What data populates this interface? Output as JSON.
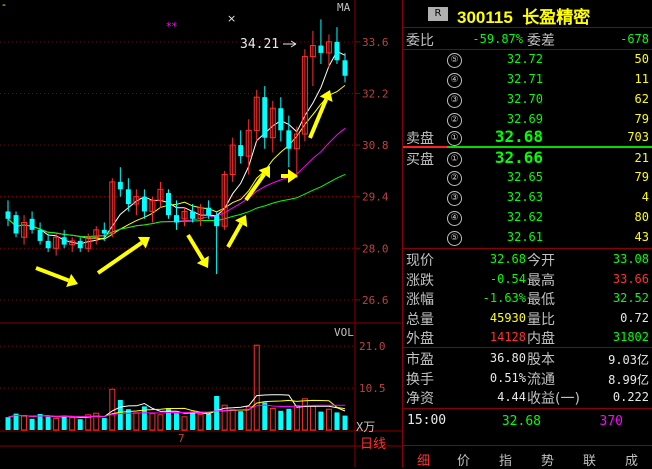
{
  "chart": {
    "ma_label": "MA",
    "vol_label": "VOL",
    "unit_label": "X万",
    "month_label": "7",
    "daily_label": "日线",
    "stars": "**",
    "high_label": "34.21",
    "price_axis": [
      "33.6",
      "32.2",
      "30.8",
      "29.4",
      "28.0",
      "26.6"
    ],
    "vol_axis": [
      "21.0",
      "10.5"
    ],
    "colors": {
      "up": "#ff3030",
      "down": "#00ffff",
      "ma5": "#ffffff",
      "ma10": "#ffff00",
      "ma20": "#ff00ff",
      "ma60": "#00ff00",
      "grid": "#8b0000",
      "arrow": "#ffff00"
    }
  },
  "chart_data": {
    "type": "candlestick",
    "ylim": [
      26.0,
      34.6
    ],
    "candles": [
      {
        "o": 29.0,
        "h": 29.3,
        "l": 28.6,
        "c": 28.8
      },
      {
        "o": 28.9,
        "h": 29.0,
        "l": 28.3,
        "c": 28.4
      },
      {
        "o": 28.3,
        "h": 28.9,
        "l": 28.1,
        "c": 28.7
      },
      {
        "o": 28.8,
        "h": 29.0,
        "l": 28.4,
        "c": 28.5
      },
      {
        "o": 28.5,
        "h": 28.7,
        "l": 28.1,
        "c": 28.2
      },
      {
        "o": 28.2,
        "h": 28.4,
        "l": 27.9,
        "c": 28.0
      },
      {
        "o": 28.0,
        "h": 28.4,
        "l": 27.8,
        "c": 28.3
      },
      {
        "o": 28.3,
        "h": 28.5,
        "l": 28.0,
        "c": 28.1
      },
      {
        "o": 28.1,
        "h": 28.3,
        "l": 27.9,
        "c": 28.2
      },
      {
        "o": 28.2,
        "h": 28.3,
        "l": 27.9,
        "c": 28.0
      },
      {
        "o": 28.0,
        "h": 28.4,
        "l": 27.9,
        "c": 28.3
      },
      {
        "o": 28.3,
        "h": 28.6,
        "l": 28.1,
        "c": 28.5
      },
      {
        "o": 28.5,
        "h": 28.7,
        "l": 28.2,
        "c": 28.4
      },
      {
        "o": 28.4,
        "h": 29.9,
        "l": 28.3,
        "c": 29.8
      },
      {
        "o": 29.8,
        "h": 30.2,
        "l": 29.4,
        "c": 29.6
      },
      {
        "o": 29.6,
        "h": 29.9,
        "l": 29.0,
        "c": 29.2
      },
      {
        "o": 29.2,
        "h": 29.6,
        "l": 28.9,
        "c": 29.4
      },
      {
        "o": 29.4,
        "h": 29.6,
        "l": 28.8,
        "c": 29.0
      },
      {
        "o": 29.0,
        "h": 29.4,
        "l": 28.7,
        "c": 29.3
      },
      {
        "o": 29.3,
        "h": 29.8,
        "l": 29.1,
        "c": 29.6
      },
      {
        "o": 29.5,
        "h": 29.6,
        "l": 28.8,
        "c": 28.9
      },
      {
        "o": 28.9,
        "h": 29.3,
        "l": 28.5,
        "c": 28.7
      },
      {
        "o": 28.8,
        "h": 29.1,
        "l": 28.6,
        "c": 29.0
      },
      {
        "o": 29.0,
        "h": 29.2,
        "l": 28.7,
        "c": 28.8
      },
      {
        "o": 28.8,
        "h": 29.2,
        "l": 28.6,
        "c": 29.1
      },
      {
        "o": 29.1,
        "h": 29.3,
        "l": 28.8,
        "c": 28.9
      },
      {
        "o": 28.9,
        "h": 29.0,
        "l": 27.3,
        "c": 28.6
      },
      {
        "o": 28.6,
        "h": 30.1,
        "l": 28.5,
        "c": 30.0
      },
      {
        "o": 30.0,
        "h": 31.0,
        "l": 29.8,
        "c": 30.8
      },
      {
        "o": 30.8,
        "h": 31.2,
        "l": 30.3,
        "c": 30.5
      },
      {
        "o": 30.5,
        "h": 31.5,
        "l": 30.0,
        "c": 31.2
      },
      {
        "o": 31.2,
        "h": 32.3,
        "l": 30.9,
        "c": 32.1
      },
      {
        "o": 32.1,
        "h": 32.4,
        "l": 30.7,
        "c": 31.0
      },
      {
        "o": 31.0,
        "h": 32.0,
        "l": 30.6,
        "c": 31.8
      },
      {
        "o": 31.8,
        "h": 32.1,
        "l": 30.9,
        "c": 31.2
      },
      {
        "o": 31.2,
        "h": 31.6,
        "l": 30.2,
        "c": 30.7
      },
      {
        "o": 30.7,
        "h": 31.3,
        "l": 29.9,
        "c": 31.1
      },
      {
        "o": 31.1,
        "h": 33.4,
        "l": 30.9,
        "c": 33.2
      },
      {
        "o": 33.2,
        "h": 33.9,
        "l": 32.4,
        "c": 33.5
      },
      {
        "o": 33.5,
        "h": 34.21,
        "l": 33.0,
        "c": 33.3
      },
      {
        "o": 33.3,
        "h": 33.8,
        "l": 32.9,
        "c": 33.6
      },
      {
        "o": 33.6,
        "h": 34.0,
        "l": 33.0,
        "c": 33.1
      },
      {
        "o": 33.1,
        "h": 33.3,
        "l": 32.5,
        "c": 32.68
      }
    ],
    "volume": [
      3.2,
      4.1,
      3.5,
      2.8,
      4.0,
      3.3,
      2.9,
      3.6,
      3.1,
      2.7,
      3.8,
      4.2,
      3.0,
      10.2,
      7.5,
      5.2,
      4.3,
      5.9,
      4.1,
      3.8,
      5.5,
      4.2,
      3.3,
      4.6,
      3.9,
      4.0,
      8.5,
      6.2,
      5.1,
      4.7,
      5.8,
      21.2,
      6.9,
      5.4,
      4.8,
      5.3,
      6.1,
      7.8,
      5.9,
      4.6,
      5.2,
      4.4,
      3.6
    ],
    "vol_ylim": [
      0,
      25
    ]
  },
  "quote": {
    "rbadge": "R",
    "code": "300115",
    "name": "长盈精密",
    "weibi_label": "委比",
    "weibi": "-59.87%",
    "weicha_label": "委差",
    "weicha": "-678",
    "sell_label": "卖盘",
    "buy_label": "买盘",
    "sells": [
      {
        "n": "⑤",
        "price": "32.72",
        "vol": "50"
      },
      {
        "n": "④",
        "price": "32.71",
        "vol": "11"
      },
      {
        "n": "③",
        "price": "32.70",
        "vol": "62"
      },
      {
        "n": "②",
        "price": "32.69",
        "vol": "79"
      },
      {
        "n": "①",
        "price": "32.68",
        "vol": "703"
      }
    ],
    "buys": [
      {
        "n": "①",
        "price": "32.66",
        "vol": "21"
      },
      {
        "n": "②",
        "price": "32.65",
        "vol": "79"
      },
      {
        "n": "③",
        "price": "32.63",
        "vol": "4"
      },
      {
        "n": "④",
        "price": "32.62",
        "vol": "80"
      },
      {
        "n": "⑤",
        "price": "32.61",
        "vol": "43"
      }
    ],
    "stats": [
      {
        "l1": "现价",
        "v1": "32.68",
        "c1": "green",
        "l2": "今开",
        "v2": "33.08",
        "c2": "green"
      },
      {
        "l1": "涨跌",
        "v1": "-0.54",
        "c1": "green",
        "l2": "最高",
        "v2": "33.66",
        "c2": "red"
      },
      {
        "l1": "涨幅",
        "v1": "-1.63%",
        "c1": "green",
        "l2": "最低",
        "v2": "32.52",
        "c2": "green"
      },
      {
        "l1": "总量",
        "v1": "45930",
        "c1": "yellow",
        "l2": "量比",
        "v2": "0.72",
        "c2": "white"
      },
      {
        "l1": "外盘",
        "v1": "14128",
        "c1": "red",
        "l2": "内盘",
        "v2": "31802",
        "c2": "green"
      }
    ],
    "stats2": [
      {
        "l1": "市盈",
        "v1": "36.80",
        "l2": "股本",
        "v2": "9.03亿"
      },
      {
        "l1": "换手",
        "v1": "0.51%",
        "l2": "流通",
        "v2": "8.99亿"
      },
      {
        "l1": "净资",
        "v1": "4.44",
        "l2": "收益(一)",
        "v2": "0.222"
      }
    ],
    "tick": {
      "time": "15:00",
      "price": "32.68",
      "vol": "370"
    },
    "tabs": [
      "细",
      "价",
      "指",
      "势",
      "联",
      "成"
    ]
  }
}
